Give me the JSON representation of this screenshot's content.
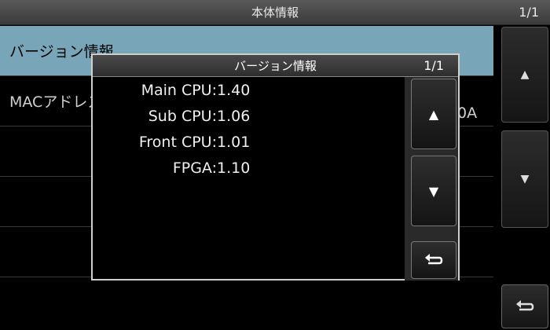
{
  "window": {
    "title": "本体情報",
    "page": "1/1"
  },
  "list": {
    "items": [
      {
        "label": "バージョン情報"
      },
      {
        "label": "MACアドレス"
      },
      {
        "label": ""
      },
      {
        "label": ""
      },
      {
        "label": ""
      }
    ],
    "mac_value_partial": "0A"
  },
  "side_buttons": {
    "up": "▲",
    "down": "▼",
    "back": "↵"
  },
  "dialog": {
    "title": "バージョン情報",
    "page": "1/1",
    "rows": [
      {
        "key": "Main CPU:",
        "value": "1.40"
      },
      {
        "key": "Sub CPU:",
        "value": "1.06"
      },
      {
        "key": "Front CPU:",
        "value": "1.01"
      },
      {
        "key": "FPGA:",
        "value": "1.10"
      }
    ],
    "buttons": {
      "up": "▲",
      "down": "▼",
      "back": "↵"
    }
  },
  "colors": {
    "selected_row": "#78a6b8",
    "background": "#000000"
  }
}
